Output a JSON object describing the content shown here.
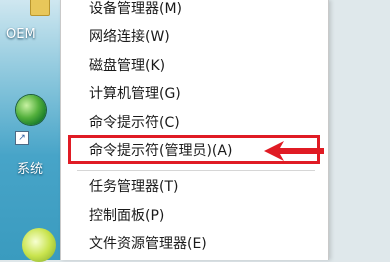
{
  "desktop": {
    "icons": [
      {
        "label": "OEM",
        "icon": "folder-icon"
      },
      {
        "label": "系统",
        "icon": "globe-icon"
      }
    ]
  },
  "context_menu": {
    "items": [
      {
        "label": "设备管理器(M)"
      },
      {
        "label": "网络连接(W)"
      },
      {
        "label": "磁盘管理(K)"
      },
      {
        "label": "计算机管理(G)"
      },
      {
        "label": "命令提示符(C)"
      },
      {
        "label": "命令提示符(管理员)(A)",
        "highlighted": true
      },
      {
        "label": "任务管理器(T)"
      },
      {
        "label": "控制面板(P)"
      },
      {
        "label": "文件资源管理器(E)"
      }
    ]
  },
  "annotation": {
    "color": "#e01b24",
    "icon": "arrow-left-icon"
  }
}
